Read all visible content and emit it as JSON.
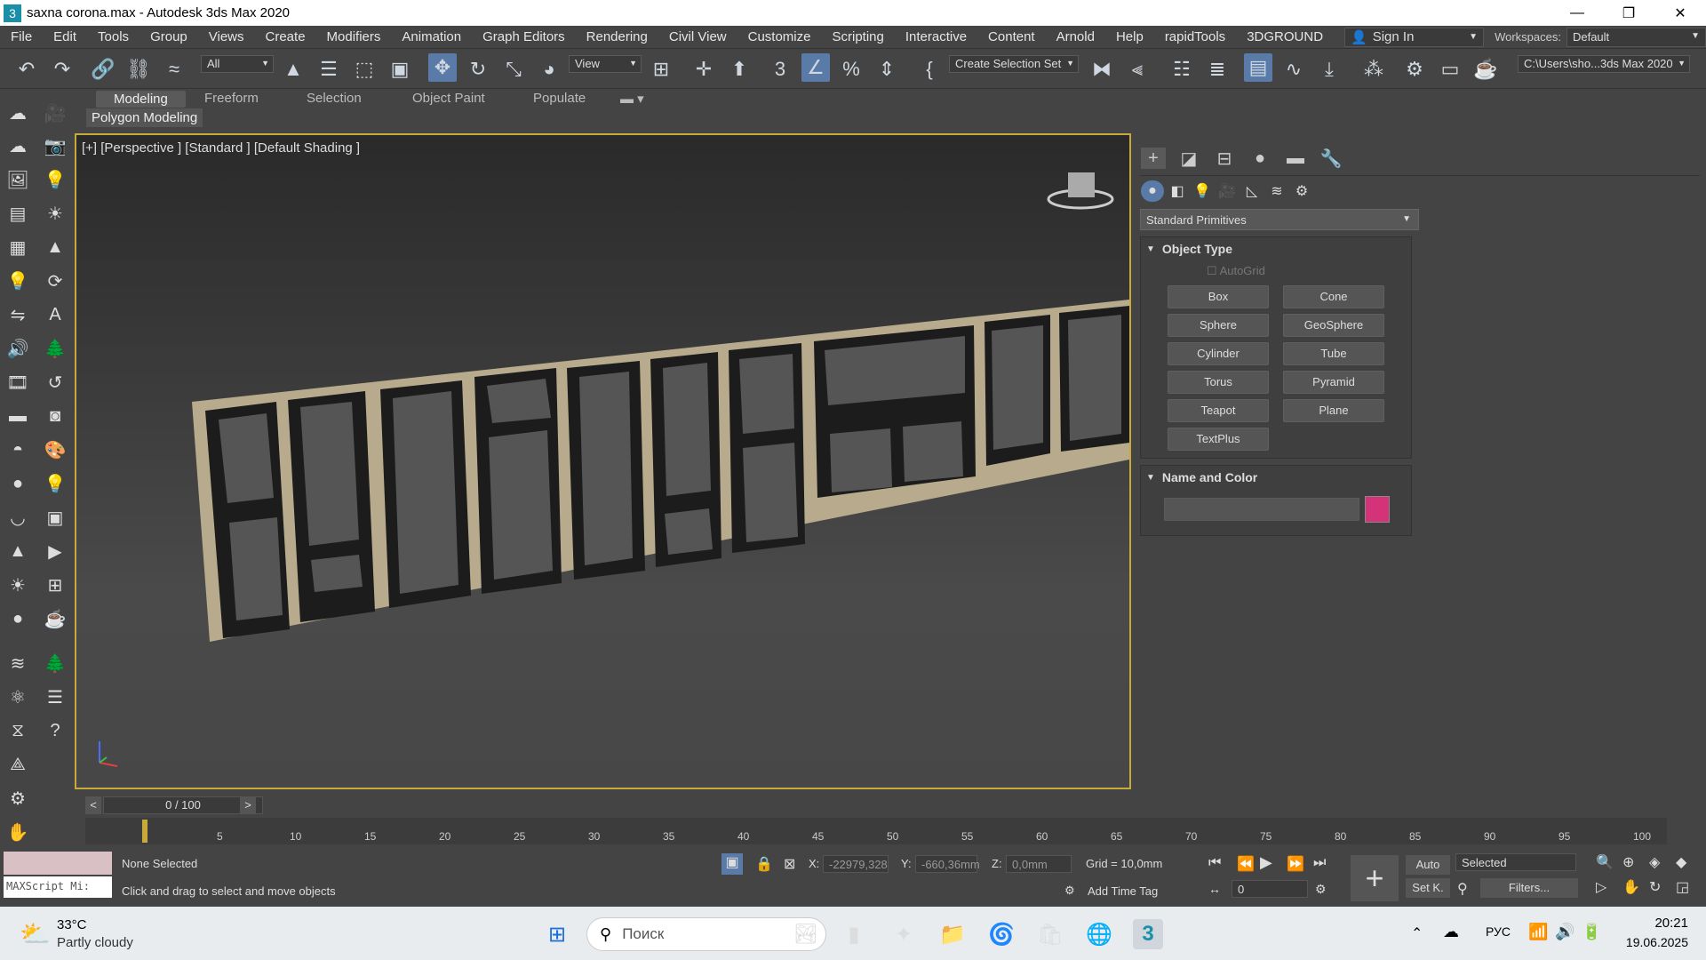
{
  "window": {
    "title": "saxna corona.max - Autodesk 3ds Max 2020"
  },
  "menu": [
    "File",
    "Edit",
    "Tools",
    "Group",
    "Views",
    "Create",
    "Modifiers",
    "Animation",
    "Graph Editors",
    "Rendering",
    "Civil View",
    "Customize",
    "Scripting",
    "Interactive",
    "Content",
    "Arnold",
    "Help",
    "rapidTools",
    "3DGROUND"
  ],
  "signin": {
    "label": "Sign In"
  },
  "workspace": {
    "label": "Workspaces:",
    "value": "Default"
  },
  "toolbar": {
    "filter": "All",
    "refcoord": "View",
    "selset": "Create Selection Set",
    "path": "C:\\Users\\sho...3ds Max 2020"
  },
  "ribbon": {
    "tabs": [
      "Modeling",
      "Freeform",
      "Selection",
      "Object Paint",
      "Populate"
    ],
    "panel": "Polygon Modeling"
  },
  "viewport": {
    "label": "[+] [Perspective ] [Standard ] [Default Shading ]"
  },
  "command_panel": {
    "category": "Standard Primitives",
    "object_type": {
      "title": "Object Type",
      "autogrid": "AutoGrid",
      "buttons": [
        "Box",
        "Cone",
        "Sphere",
        "GeoSphere",
        "Cylinder",
        "Tube",
        "Torus",
        "Pyramid",
        "Teapot",
        "Plane",
        "TextPlus"
      ]
    },
    "name_color": {
      "title": "Name and Color",
      "name": "",
      "color": "#d4337a"
    }
  },
  "time": {
    "slider": "0 / 100",
    "ticks": [
      "5",
      "10",
      "15",
      "20",
      "25",
      "30",
      "35",
      "40",
      "45",
      "50",
      "55",
      "60",
      "65",
      "70",
      "75",
      "80",
      "85",
      "90",
      "95",
      "100"
    ]
  },
  "status": {
    "script": "MAXScript Mi:",
    "selected": "None Selected",
    "prompt": "Click and drag to select and move objects",
    "x_label": "X:",
    "x": "-22979,328",
    "y_label": "Y:",
    "y": "-660,36mm",
    "z_label": "Z:",
    "z": "0,0mm",
    "grid": "Grid = 10,0mm",
    "addtime": "Add Time Tag",
    "auto": "Auto",
    "setk": "Set K.",
    "selmode": "Selected",
    "filters": "Filters...",
    "frame": "0"
  },
  "taskbar": {
    "temp": "33°C",
    "weather": "Partly cloudy",
    "search": "Поиск",
    "lang": "РУС",
    "time": "20:21",
    "date": "19.06.2025"
  }
}
